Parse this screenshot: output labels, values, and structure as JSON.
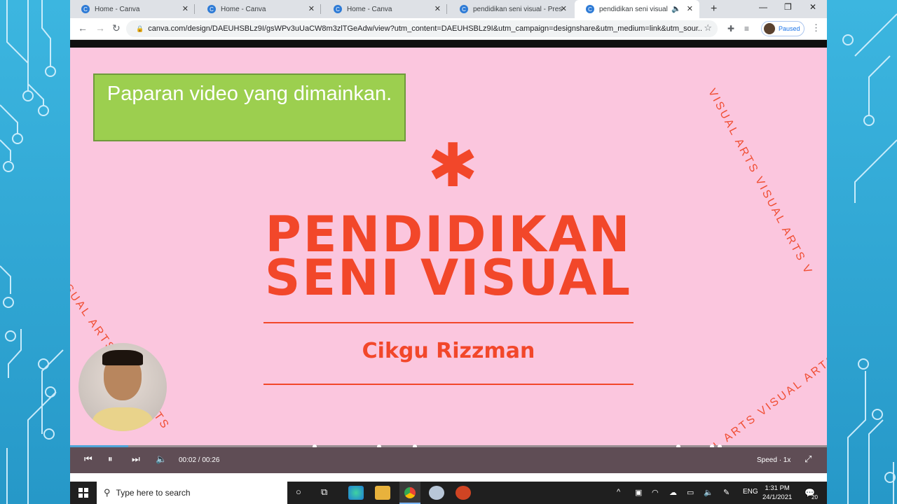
{
  "browser": {
    "tabs": [
      {
        "title": "Home - Canva",
        "active": false
      },
      {
        "title": "Home - Canva",
        "active": false
      },
      {
        "title": "Home - Canva",
        "active": false
      },
      {
        "title": "pendidikan seni visual - Presen",
        "active": false
      },
      {
        "title": "pendidikan seni visual",
        "active": true
      }
    ],
    "url": "canva.com/design/DAEUHSBLz9I/gsWPv3uUaCW8m3zlTGeAdw/view?utm_content=DAEUHSBLz9I&utm_campaign=designshare&utm_medium=link&utm_sour...",
    "profile_status": "Paused",
    "icons": [
      "back-icon",
      "forward-icon",
      "reload-icon",
      "lock-icon",
      "star-icon",
      "extensions-icon",
      "media-icon",
      "menu-icon"
    ]
  },
  "slide": {
    "note": "Paparan video yang dimainkan.",
    "title_line1": "PENDIDIKAN",
    "title_line2": "SENI VISUAL",
    "author": "Cikgu Rizzman",
    "arc_text_left": "VISUAL ARTSVISUAL ARTS",
    "arc_text_right_top": "VISUAL ARTS VISUAL ARTS V",
    "arc_text_right_bottom": "VISUAL ARTS VISUAL ARTS",
    "accent_color": "#f2472a",
    "background_color": "#fbc6de"
  },
  "player": {
    "time": "00:02 / 00:26",
    "speed": "Speed · 1x",
    "progress_fraction": 0.077
  },
  "taskbar": {
    "search_placeholder": "Type here to search",
    "language": "ENG",
    "time": "1:31 PM",
    "date": "24/1/2021",
    "notification_count": "20"
  }
}
